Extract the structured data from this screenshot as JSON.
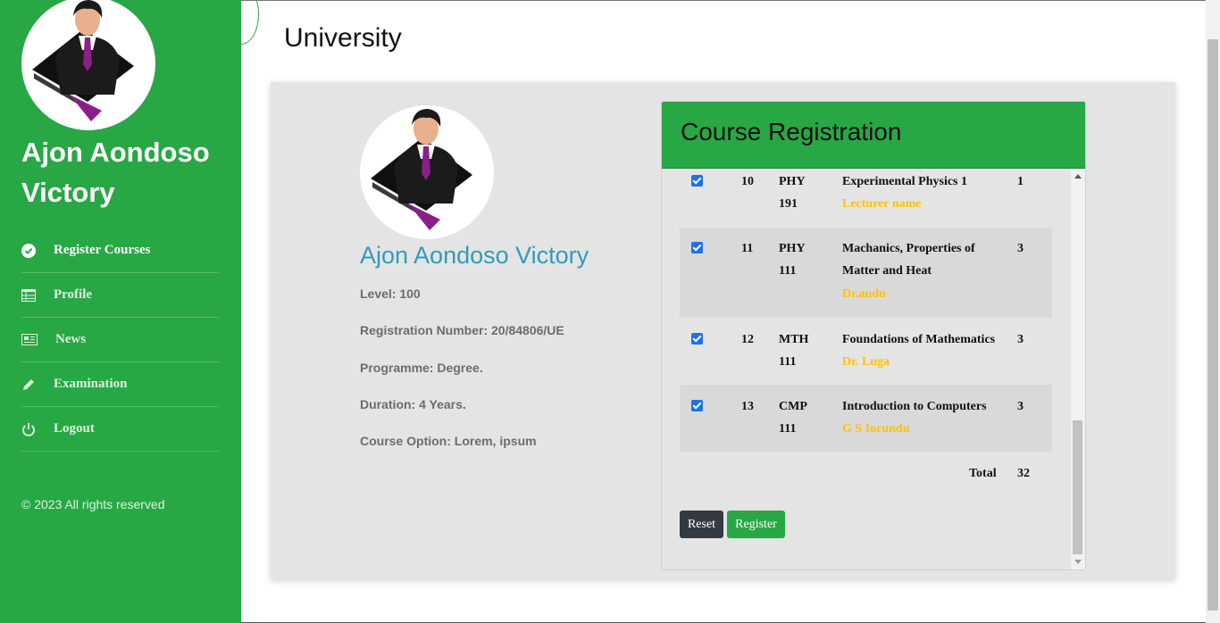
{
  "sidebar": {
    "name": "Ajon Aondoso Victory",
    "menu": [
      {
        "label": "Register Courses",
        "icon": "check-circle-icon"
      },
      {
        "label": "Profile",
        "icon": "table-icon"
      },
      {
        "label": "News",
        "icon": "newspaper-icon"
      },
      {
        "label": "Examination",
        "icon": "pencil-icon"
      },
      {
        "label": "Logout",
        "icon": "power-icon"
      }
    ],
    "footer": "© 2023 All rights reserved"
  },
  "header": {
    "title": "University"
  },
  "profile": {
    "name": "Ajon Aondoso Victory",
    "level": "Level: 100",
    "reg_number": "Registration Number: 20/84806/UE",
    "programme": "Programme: Degree.",
    "duration": "Duration: 4 Years.",
    "course_option": "Course Option: Lorem, ipsum"
  },
  "registration": {
    "title": "Course Registration",
    "courses": [
      {
        "num": "10",
        "code_a": "PHY",
        "code_b": "191",
        "title_a": "Experimental Physics 1",
        "title_b": "",
        "lecturer": "Lecturer name",
        "units": "1",
        "checked": true
      },
      {
        "num": "11",
        "code_a": "PHY",
        "code_b": "111",
        "title_a": "Machanics, Properties of",
        "title_b": "Matter and Heat",
        "lecturer": "Dr.audu",
        "units": "3",
        "checked": true
      },
      {
        "num": "12",
        "code_a": "MTH",
        "code_b": "111",
        "title_a": "Foundations of Mathematics",
        "title_b": "",
        "lecturer": "Dr. Luga",
        "units": "3",
        "checked": true
      },
      {
        "num": "13",
        "code_a": "CMP",
        "code_b": "111",
        "title_a": "Introduction to Computers",
        "title_b": "",
        "lecturer": "G S Iorundu",
        "units": "3",
        "checked": true
      }
    ],
    "total_label": "Total",
    "total_value": "32",
    "reset_label": "Reset",
    "register_label": "Register"
  },
  "colors": {
    "primary": "#28a745",
    "accent_text": "#2f9cbb",
    "lecturer": "#ffc107",
    "dark_button": "#343a40"
  }
}
